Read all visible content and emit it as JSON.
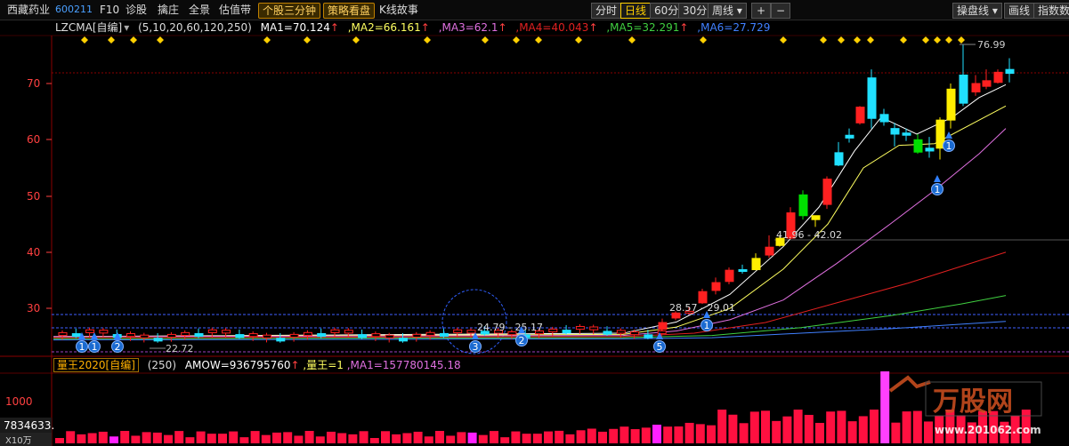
{
  "toolbar": {
    "stock_name": "西藏药业",
    "stock_code": "600211",
    "f10": "F10",
    "diagnose": "诊股",
    "tag": "擒庄",
    "panorama": "全景",
    "valuation": "估值带",
    "three_min": "个股三分钟",
    "strategy": "策略看盘",
    "kline_story": "K线故事",
    "periods": [
      "分时",
      "日线",
      "60分",
      "30分",
      "周线 ▾"
    ],
    "plus": "+",
    "minus": "−",
    "right_buttons": [
      "操盘线 ▾",
      "画线",
      "指数数"
    ]
  },
  "indicator_main": {
    "name": "LZCMA[自编]",
    "params": "(5,10,20,60,120,250)",
    "ma1": "MA1=70.124",
    "ma2": ",MA2=66.161",
    "ma3": ",MA3=62.1",
    "ma4": ",MA4=40.043",
    "ma5": ",MA5=32.291",
    "ma6": ",MA6=27.729",
    "arrow": "↑"
  },
  "indicator_sub": {
    "name": "量王2020[自编]",
    "params": "(250)",
    "amow": "AMOW=936795760",
    "arrow": "↑",
    "lw": ",量王=1",
    "ma1": ",MA1=157780145.18"
  },
  "y_axis_labels": [
    "70",
    "60",
    "50",
    "40",
    "30"
  ],
  "sub_axis_labels": [
    "1000",
    "7834633."
  ],
  "sub_corner": "X10万",
  "annotations": {
    "high": "76.99",
    "low": "22.72",
    "range1": "41.96 - 42.02",
    "range2": "28.57 - 29.01",
    "range3": "24.79 - 25.17"
  },
  "badges": [
    "1",
    "1",
    "2",
    "3",
    "2",
    "5",
    "1",
    "1",
    "1"
  ],
  "watermark": "万股网",
  "watermark_url": "www.201062.com",
  "colors": {
    "up": "#ff2020",
    "down": "#20e0ff",
    "yellow": "#ffee00",
    "green": "#00e000",
    "ma1": "#ffffff",
    "ma2": "#ffff60",
    "ma3": "#e070e0",
    "ma4": "#e02020",
    "ma5": "#40d040",
    "ma6": "#4080ff"
  }
}
